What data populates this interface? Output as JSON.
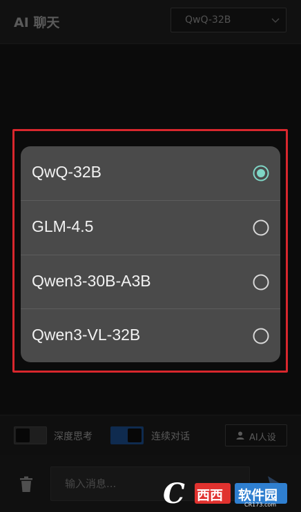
{
  "header": {
    "title": "AI 聊天",
    "model_select": {
      "value": "QwQ-32B"
    }
  },
  "model_picker": {
    "options": [
      {
        "label": "QwQ-32B",
        "selected": true
      },
      {
        "label": "GLM-4.5",
        "selected": false
      },
      {
        "label": "Qwen3-30B-A3B",
        "selected": false
      },
      {
        "label": "Qwen3-VL-32B",
        "selected": false
      }
    ],
    "accent": "#7fd6c6"
  },
  "controls": {
    "deep_think": {
      "label": "深度思考",
      "on": false
    },
    "continuous": {
      "label": "连续对话",
      "on": true
    },
    "persona_button": "AI人设"
  },
  "composer": {
    "placeholder": "输入消息..."
  },
  "watermark": {
    "brand_red": "西西",
    "brand_blue": "软件园",
    "url": "CR173.com"
  },
  "colors": {
    "background": "#111111",
    "highlight_border": "#d9272d",
    "toggle_on": "#17427a"
  }
}
